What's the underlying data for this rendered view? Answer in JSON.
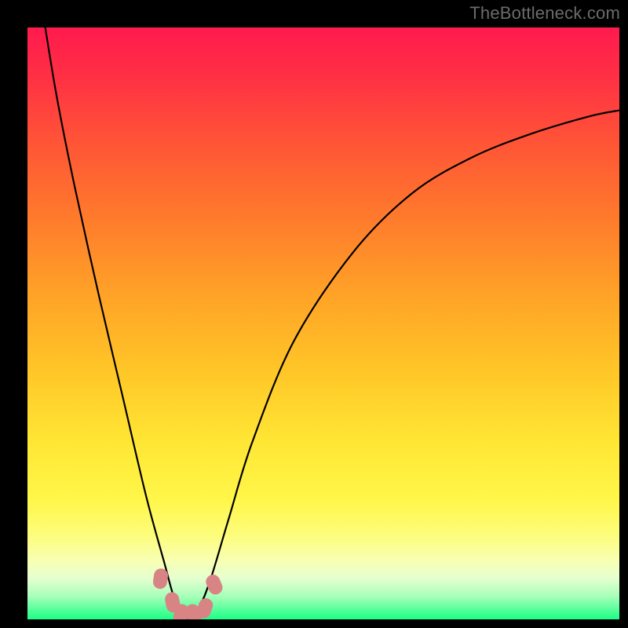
{
  "watermark": "TheBottleneck.com",
  "chart_data": {
    "type": "line",
    "title": "",
    "xlabel": "",
    "ylabel": "",
    "xlim": [
      0,
      100
    ],
    "ylim": [
      0,
      100
    ],
    "grid": false,
    "legend": false,
    "background_gradient": {
      "stops": [
        {
          "pos": 0,
          "color": "#ff1a4e"
        },
        {
          "pos": 20,
          "color": "#ff5636"
        },
        {
          "pos": 45,
          "color": "#ffa227"
        },
        {
          "pos": 70,
          "color": "#ffe634"
        },
        {
          "pos": 86,
          "color": "#fdfd7e"
        },
        {
          "pos": 93,
          "color": "#e6ffd0"
        },
        {
          "pos": 100,
          "color": "#1cff86"
        }
      ]
    },
    "series": [
      {
        "name": "bottleneck-curve",
        "description": "Asymmetric V-shaped bottleneck curve; minimum near x≈27, y≈0",
        "x": [
          3,
          5,
          8,
          12,
          16,
          20,
          23,
          25,
          27,
          29,
          31,
          34,
          38,
          45,
          55,
          65,
          75,
          85,
          95,
          100
        ],
        "y": [
          100,
          88,
          73,
          55,
          38,
          21,
          10,
          3,
          0,
          2,
          7,
          17,
          30,
          47,
          62,
          72,
          78,
          82,
          85,
          86
        ]
      }
    ],
    "markers": {
      "name": "minimum-markers",
      "color": "#d98484",
      "points": [
        {
          "x": 22.5,
          "y": 7
        },
        {
          "x": 24.5,
          "y": 3
        },
        {
          "x": 26.0,
          "y": 1
        },
        {
          "x": 28.0,
          "y": 1
        },
        {
          "x": 30.0,
          "y": 2
        },
        {
          "x": 31.5,
          "y": 6
        }
      ]
    }
  }
}
